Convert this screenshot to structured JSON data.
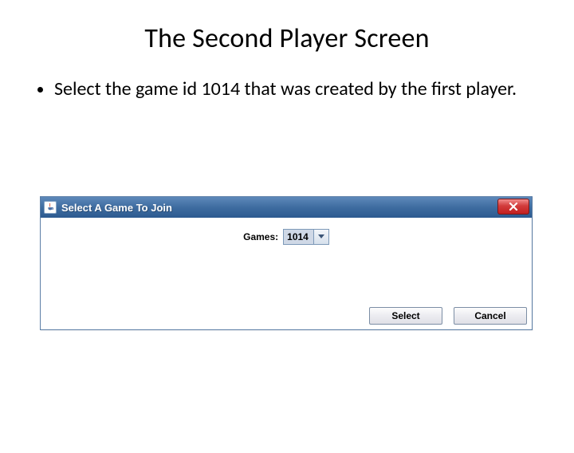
{
  "slide": {
    "title": "The Second Player Screen",
    "bullet": "Select the game id 1014 that was created by the first player."
  },
  "dialog": {
    "title": "Select A Game To Join",
    "close_tooltip": "Close",
    "games_label": "Games:",
    "games_selected": "1014",
    "buttons": {
      "select": "Select",
      "cancel": "Cancel"
    }
  }
}
